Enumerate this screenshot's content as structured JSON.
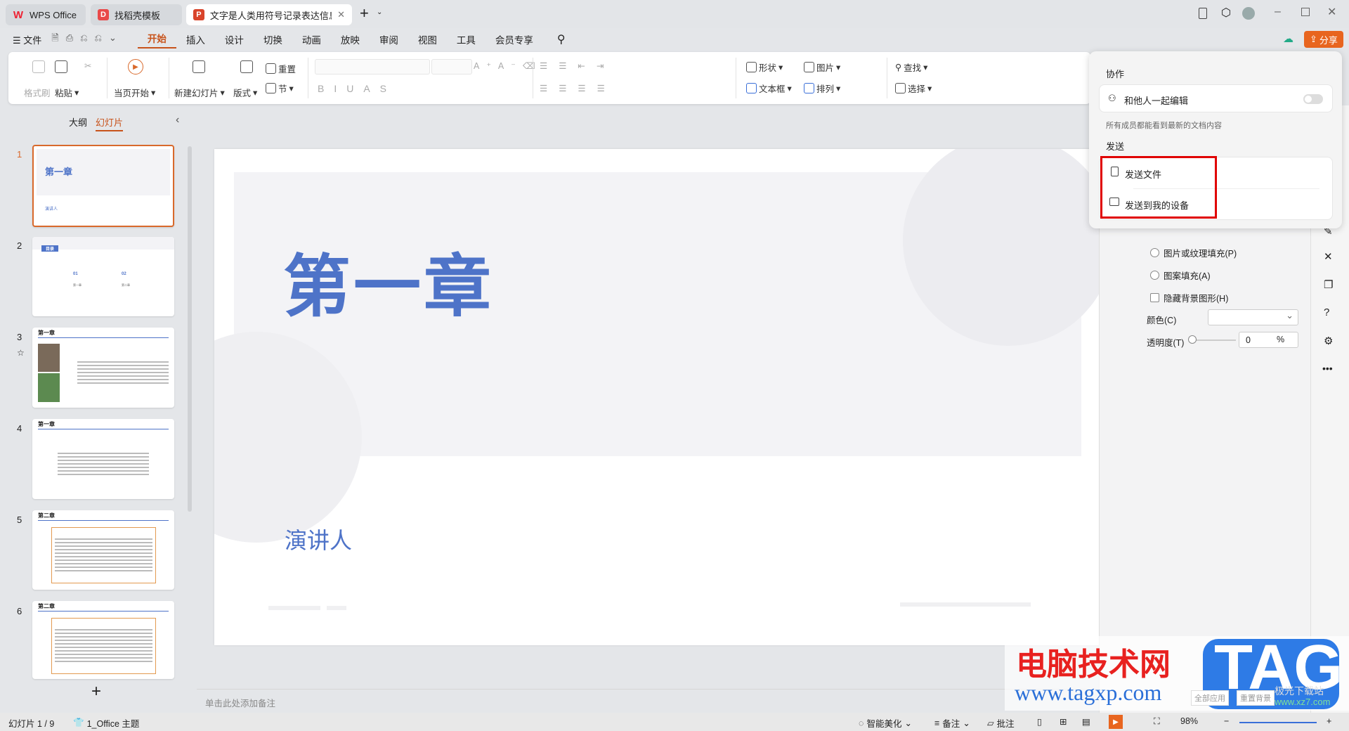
{
  "titlebar": {
    "tabs": [
      {
        "label": "WPS Office"
      },
      {
        "label": "找稻壳模板"
      },
      {
        "label": "文字是人类用符号记录表达信息以"
      }
    ],
    "new_tab": "+"
  },
  "menu": {
    "file": "文件",
    "tabs": [
      "开始",
      "插入",
      "设计",
      "切换",
      "动画",
      "放映",
      "审阅",
      "视图",
      "工具",
      "会员专享"
    ],
    "share": "分享"
  },
  "ribbon": {
    "format_painter": "格式刷",
    "paste": "粘贴",
    "from_current": "当页开始",
    "new_slide": "新建幻灯片",
    "layout": "版式",
    "reset": "重置",
    "section": "节",
    "shape": "形状",
    "picture": "图片",
    "textbox": "文本框",
    "arrange": "排列",
    "find": "查找",
    "select": "选择"
  },
  "left_panel": {
    "tab_outline": "大纲",
    "tab_slides": "幻灯片",
    "add": "+",
    "slides": [
      {
        "n": "1",
        "title": "第一章",
        "sub": "演讲人"
      },
      {
        "n": "2",
        "title": "目录",
        "items": [
          "01",
          "02"
        ],
        "labels": [
          "第一章",
          "第二章"
        ]
      },
      {
        "n": "3",
        "title": "第一章"
      },
      {
        "n": "4",
        "title": "第一章"
      },
      {
        "n": "5",
        "title": "第二章"
      },
      {
        "n": "6",
        "title": "第二章"
      }
    ]
  },
  "slide": {
    "title": "第一章",
    "subtitle": "演讲人",
    "title_color": "#4e73c8"
  },
  "notes": {
    "placeholder": "单击此处添加备注"
  },
  "right_pane": {
    "options": [
      "图片或纹理填充(P)",
      "图案填充(A)"
    ],
    "hide_bg": "隐藏背景图形(H)",
    "color_label": "颜色(C)",
    "transparency_label": "透明度(T)",
    "transparency_value": "0",
    "percent": "%",
    "apply_all": "全部应用",
    "reset_bg": "重置背景"
  },
  "popup": {
    "collab_heading": "协作",
    "coedit": "和他人一起编辑",
    "coedit_on": false,
    "coedit_hint": "所有成员都能看到最新的文档内容",
    "send_heading": "发送",
    "send_file": "发送文件",
    "send_device": "发送到我的设备"
  },
  "status": {
    "slide_info": "幻灯片 1 / 9",
    "theme": "1_Office 主题",
    "beautify": "智能美化",
    "notes": "备注",
    "comment": "批注",
    "zoom": "98%"
  },
  "watermark": {
    "cn": "电脑技术网",
    "tag": "TAG",
    "url": "www.tagxp.com",
    "site2": "极光下载站",
    "url2": "www.xz7.com"
  },
  "colors": {
    "accent": "#d9692b",
    "share": "#e8651f",
    "highlight": "#e00000"
  }
}
